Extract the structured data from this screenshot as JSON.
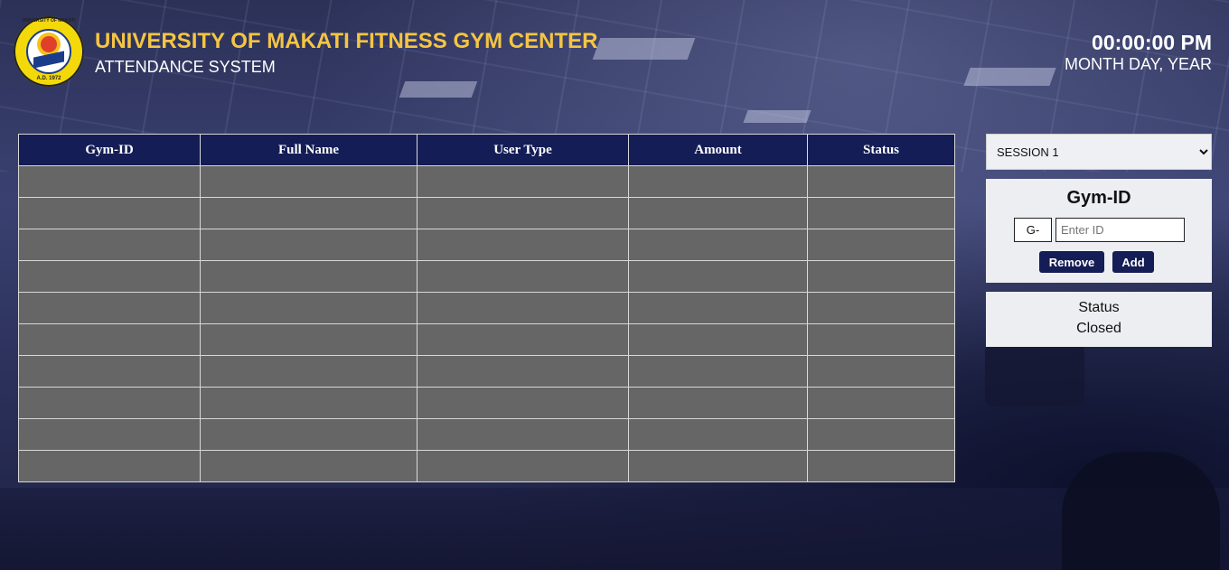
{
  "header": {
    "logo_ring_text": "UNIVERSITY OF MAKATI",
    "logo_year": "A.D. 1972",
    "title": "UNIVERSITY OF MAKATI FITNESS GYM CENTER",
    "subtitle": "ATTENDANCE SYSTEM",
    "time": "00:00:00 PM",
    "date": "MONTH DAY, YEAR"
  },
  "table": {
    "columns": [
      "Gym-ID",
      "Full Name",
      "User Type",
      "Amount",
      "Status"
    ],
    "rows": [
      [
        "",
        "",
        "",
        "",
        ""
      ],
      [
        "",
        "",
        "",
        "",
        ""
      ],
      [
        "",
        "",
        "",
        "",
        ""
      ],
      [
        "",
        "",
        "",
        "",
        ""
      ],
      [
        "",
        "",
        "",
        "",
        ""
      ],
      [
        "",
        "",
        "",
        "",
        ""
      ],
      [
        "",
        "",
        "",
        "",
        ""
      ],
      [
        "",
        "",
        "",
        "",
        ""
      ],
      [
        "",
        "",
        "",
        "",
        ""
      ],
      [
        "",
        "",
        "",
        "",
        ""
      ]
    ]
  },
  "sidebar": {
    "session_options": [
      "SESSION 1"
    ],
    "session_selected": "SESSION 1",
    "id_panel": {
      "heading": "Gym-ID",
      "prefix": "G-",
      "input_value": "",
      "input_placeholder": "Enter ID",
      "remove_label": "Remove",
      "add_label": "Add"
    },
    "status_panel": {
      "label": "Status",
      "value": "Closed"
    }
  },
  "colors": {
    "accent_navy": "#141d55",
    "title_gold": "#f5c542",
    "cell_gray": "#666666",
    "panel_bg": "#eceef2"
  }
}
